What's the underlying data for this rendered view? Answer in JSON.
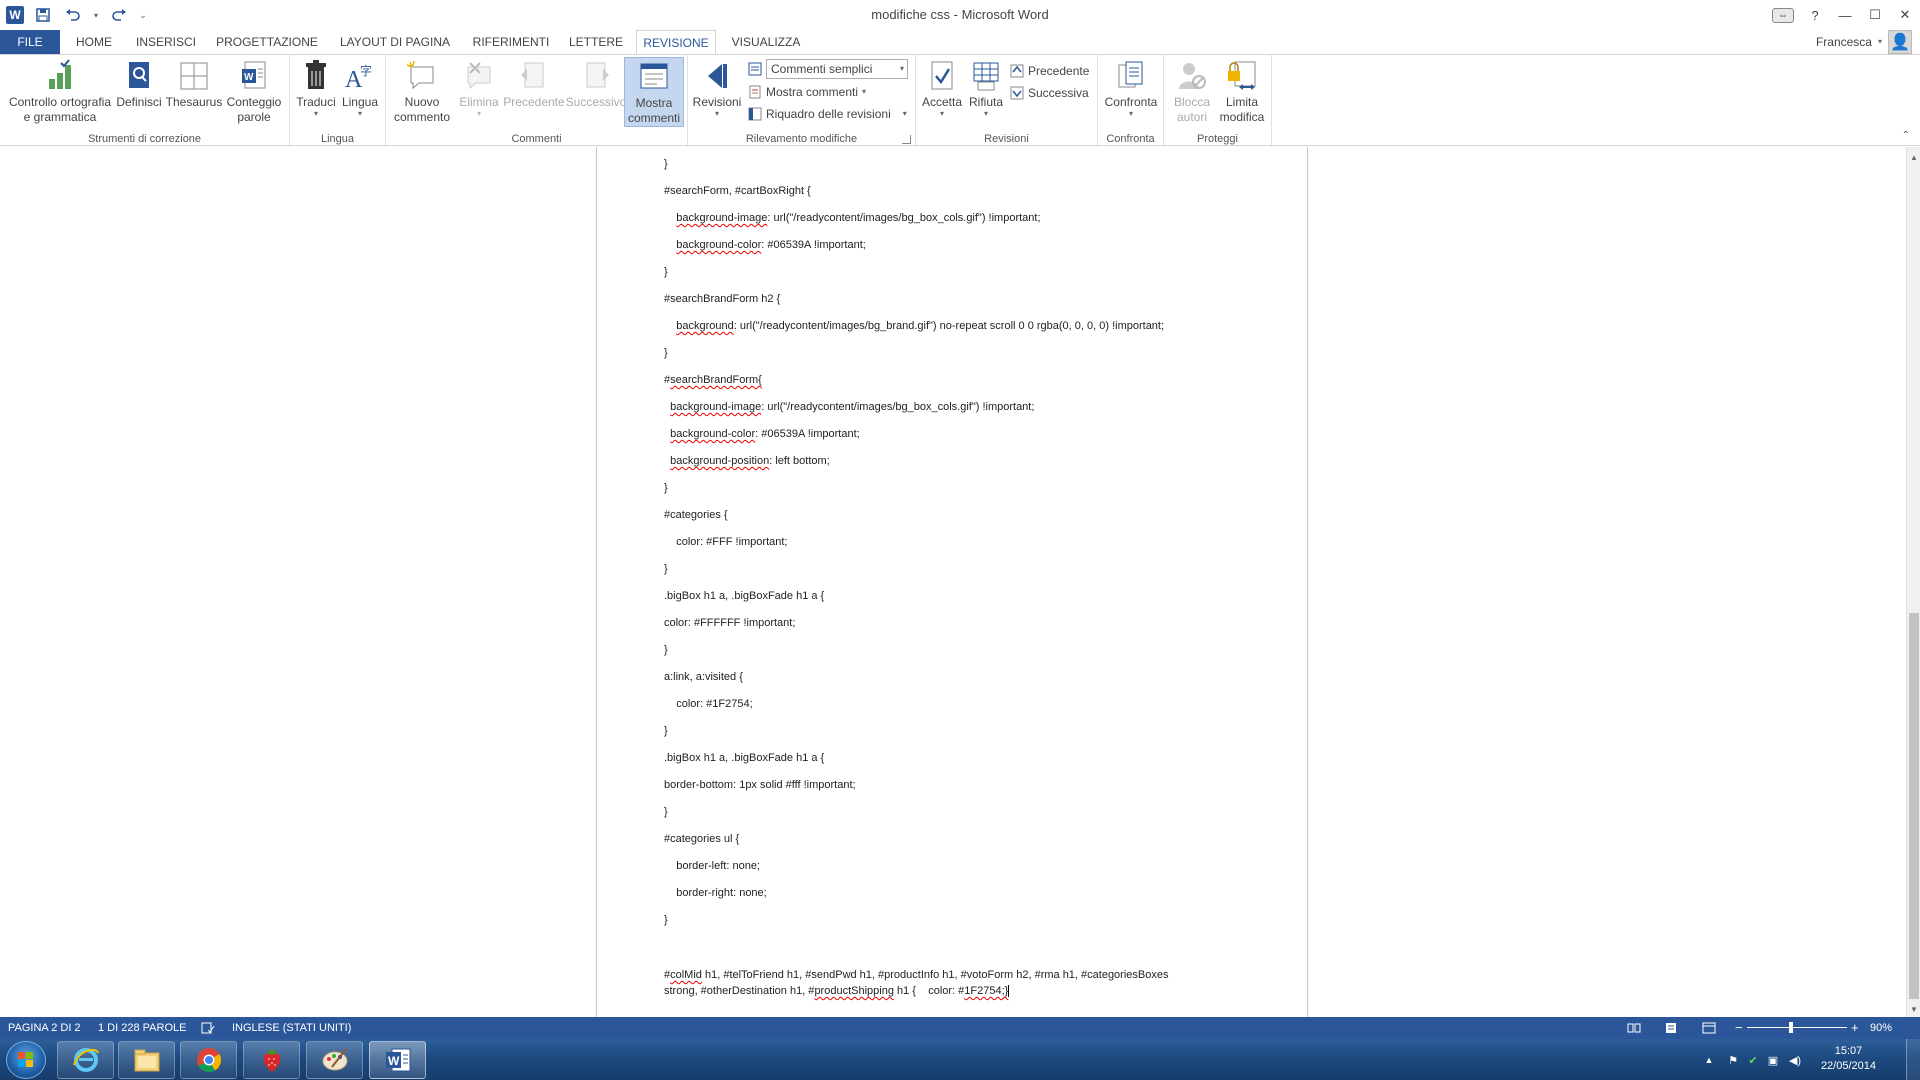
{
  "window": {
    "title": "modifiche css - Microsoft Word",
    "user": "Francesca"
  },
  "tabs": [
    {
      "label": "FILE"
    },
    {
      "label": "HOME"
    },
    {
      "label": "INSERISCI"
    },
    {
      "label": "PROGETTAZIONE"
    },
    {
      "label": "LAYOUT DI PAGINA"
    },
    {
      "label": "RIFERIMENTI"
    },
    {
      "label": "LETTERE"
    },
    {
      "label": "REVISIONE"
    },
    {
      "label": "VISUALIZZA"
    }
  ],
  "active_tab": "REVISIONE",
  "ribbon": {
    "proofing": {
      "label": "Strumenti di correzione",
      "spelling": "Controllo ortografia\ne grammatica",
      "define": "Definisci",
      "thesaurus": "Thesaurus",
      "wordcount": "Conteggio\nparole"
    },
    "language": {
      "label": "Lingua",
      "translate": "Traduci",
      "language": "Lingua"
    },
    "comments": {
      "label": "Commenti",
      "new": "Nuovo\ncommento",
      "delete": "Elimina",
      "previous": "Precedente",
      "next": "Successivo",
      "show": "Mostra\ncommenti"
    },
    "tracking": {
      "label": "Rilevamento modifiche",
      "track": "Revisioni",
      "markup_select": "Commenti semplici",
      "show_markup": "Mostra commenti",
      "reviewing_pane": "Riquadro delle revisioni"
    },
    "changes": {
      "label": "Revisioni",
      "accept": "Accetta",
      "reject": "Rifiuta",
      "previous": "Precedente",
      "next": "Successiva"
    },
    "compare": {
      "label": "Confronta",
      "compare": "Confronta"
    },
    "protect": {
      "label": "Proteggi",
      "block": "Blocca\nautori",
      "restrict": "Limita\nmodifica"
    }
  },
  "document": {
    "lines": [
      [
        {
          "t": "}"
        }
      ],
      [
        {
          "t": "#searchForm, #cartBoxRight {"
        }
      ],
      [
        {
          "t": "    "
        },
        {
          "t": "background-image",
          "sq": true
        },
        {
          "t": ": url(\"/readycontent/images/bg_box_cols.gif\") !important;"
        }
      ],
      [
        {
          "t": "    "
        },
        {
          "t": "background-color",
          "sq": true
        },
        {
          "t": ": #06539A !important;"
        }
      ],
      [
        {
          "t": "}"
        }
      ],
      [
        {
          "t": "#searchBrandForm h2 {"
        }
      ],
      [
        {
          "t": "    "
        },
        {
          "t": "background",
          "sq": true
        },
        {
          "t": ": url(\"/readycontent/images/bg_brand.gif\") no-repeat scroll 0 0 rgba(0, 0, 0, 0) !important;"
        }
      ],
      [
        {
          "t": "}"
        }
      ],
      [
        {
          "t": "#"
        },
        {
          "t": "searchBrandForm{",
          "sq": true
        }
      ],
      [
        {
          "t": "  "
        },
        {
          "t": "background-image",
          "sq": true
        },
        {
          "t": ": url(\"/readycontent/images/bg_box_cols.gif\") !important;"
        }
      ],
      [
        {
          "t": "  "
        },
        {
          "t": "background-color",
          "sq": true
        },
        {
          "t": ": #06539A !important;"
        }
      ],
      [
        {
          "t": "  "
        },
        {
          "t": "background-position",
          "sq": true
        },
        {
          "t": ": left bottom;"
        }
      ],
      [
        {
          "t": "}"
        }
      ],
      [
        {
          "t": "#categories {"
        }
      ],
      [
        {
          "t": "    color: #FFF !important;"
        }
      ],
      [
        {
          "t": "}"
        }
      ],
      [
        {
          "t": ".bigBox h1 a, .bigBoxFade h1 a {"
        }
      ],
      [
        {
          "t": "color: #FFFFFF !important;"
        }
      ],
      [
        {
          "t": "}"
        }
      ],
      [
        {
          "t": "a:link, a:visited {"
        }
      ],
      [
        {
          "t": "    color: #1F2754;"
        }
      ],
      [
        {
          "t": "}"
        }
      ],
      [
        {
          "t": ".bigBox h1 a, .bigBoxFade h1 a {"
        }
      ],
      [
        {
          "t": "border-bottom: 1px solid #fff !important;"
        }
      ],
      [
        {
          "t": "}"
        }
      ],
      [
        {
          "t": "#categories ul {"
        }
      ],
      [
        {
          "t": "    border-left: none;"
        }
      ],
      [
        {
          "t": "    border-right: none;"
        }
      ],
      [
        {
          "t": "}"
        }
      ]
    ],
    "final_line_1": [
      {
        "t": "#"
      },
      {
        "t": "colMid",
        "sq": true
      },
      {
        "t": " h1, #telToFriend h1, #sendPwd h1, #productInfo h1, #votoForm h2, #rma h1, #categoriesBoxes"
      }
    ],
    "final_line_2": [
      {
        "t": "strong, #otherDestination h1, #"
      },
      {
        "t": "productShipping",
        "sq": true
      },
      {
        "t": " h1 {    color: #"
      },
      {
        "t": "1F2754;}",
        "sq": true
      }
    ]
  },
  "status": {
    "page": "PAGINA 2 DI 2",
    "words": "1 DI 228 PAROLE",
    "language": "INGLESE (STATI UNITI)",
    "zoom": "90%",
    "zoom_level": 0.9
  },
  "taskbar": {
    "apps": [
      "start-button",
      "internet-explorer",
      "file-explorer",
      "chrome",
      "strawberry-app",
      "paint",
      "word"
    ],
    "time": "15:07",
    "date": "22/05/2014"
  },
  "colors": {
    "accent": "#2b579a",
    "squiggle": "#e00000"
  }
}
